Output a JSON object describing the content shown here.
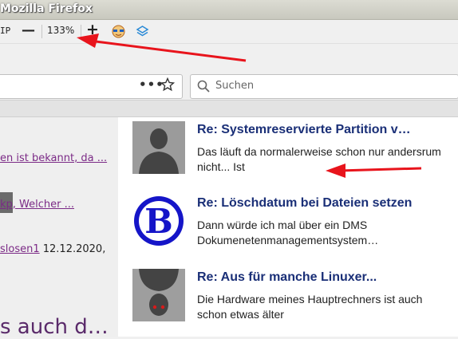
{
  "window": {
    "title": "Mozilla Firefox"
  },
  "toolbar": {
    "ip_fragment": "IP",
    "zoom_out": "—",
    "zoom_level": "133%",
    "zoom_in": "+"
  },
  "navbar": {
    "url_menu": "•••",
    "search_placeholder": "Suchen"
  },
  "sidebar": {
    "link1": "en ist bekannt, da ...",
    "link2": "kp, Welcher ...",
    "author": "slosen1",
    "date": " 12.12.2020,",
    "heading": "s auch d…"
  },
  "posts": [
    {
      "title": "Re: Systemreservierte Partition v…",
      "body": "Das läuft da normalerweise schon nur andersrum nicht... Ist",
      "avatar": "person-silhouette-icon"
    },
    {
      "title": "Re: Löschdatum bei Dateien setzen",
      "body": "Dann würde ich mal über ein DMS Dokumenetenmanagementsystem…",
      "avatar": "letter-b-logo-icon"
    },
    {
      "title": "Re: Aus für manche Linuxer...",
      "body": "Die Hardware meines Hauptrechners ist auch schon etwas älter",
      "avatar": "upside-down-face-icon"
    }
  ],
  "colors": {
    "link_visited": "#7b2a86",
    "post_title": "#1a2f77",
    "annotation": "#e8141c"
  }
}
